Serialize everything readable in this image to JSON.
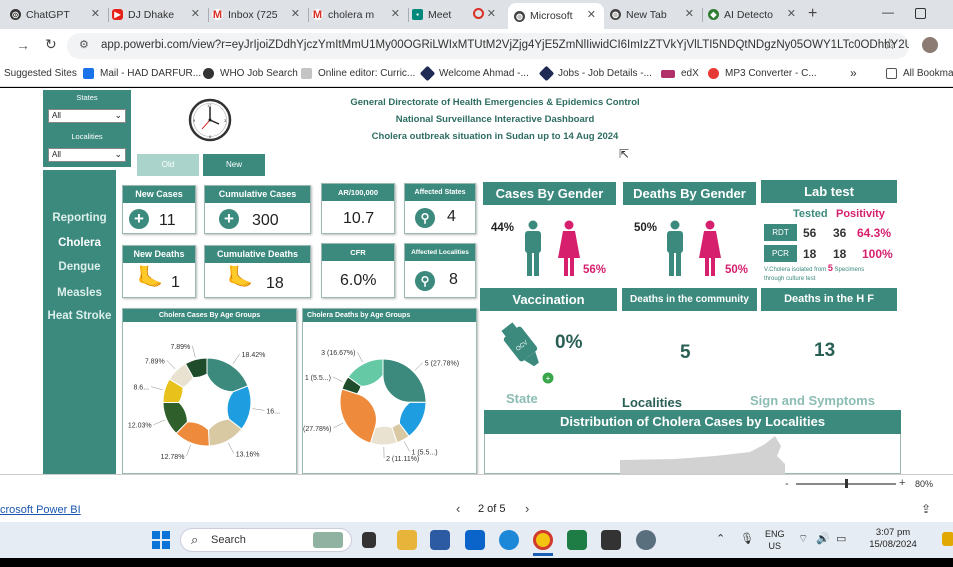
{
  "browser": {
    "tabs": [
      {
        "label": "ChatGPT",
        "color": "#333"
      },
      {
        "label": "DJ Dhake",
        "color": "#e62117"
      },
      {
        "label": "Inbox (725",
        "color": "#d93025"
      },
      {
        "label": "cholera m",
        "color": "#d93025"
      },
      {
        "label": "Meet",
        "color": "#00897b"
      },
      {
        "label": "Microsoft",
        "color": "#444"
      },
      {
        "label": "New Tab",
        "color": "#444"
      },
      {
        "label": "AI Detecto",
        "color": "#2e7d32"
      }
    ],
    "new_tab_symbol": "+",
    "url": "app.powerbi.com/view?r=eyJrIjoiZDdhYjczYmItMmU1My00OGRiLWIxMTUtM2VjZjg4YjE5ZmNlIiwidCI6ImIzZTVkYjVlLTI5NDQtNDgzNy05OWY1LTc0ODhhY2U1N...",
    "bookmarks": [
      "Suggested Sites",
      "Mail - HAD DARFUR...",
      "WHO Job Search",
      "Online editor: Curric...",
      "Welcome Ahmad -...",
      "Jobs - Job Details -...",
      "edX",
      "MP3 Converter - C..."
    ],
    "bookmarks_overflow": "»",
    "all_bookmarks": "All Bookmarks"
  },
  "filters": {
    "states_label": "States",
    "states_value": "All",
    "localities_label": "Localities",
    "localities_value": "All",
    "old_label": "Old",
    "new_label": "New"
  },
  "nav": [
    "Reporting",
    "Cholera",
    "Dengue",
    "Measles",
    "Heat Stroke"
  ],
  "header": {
    "line1": "General Directorate of Health Emergencies &  Epidemics Control",
    "line2": "National Surveillance Interactive Dashboard",
    "line3": "Cholera  outbreak situation in Sudan up to 14 Aug 2024"
  },
  "kpis": {
    "new_cases": {
      "label": "New Cases",
      "value": "11"
    },
    "cumulative_cases": {
      "label": "Cumulative Cases",
      "value": "300"
    },
    "ar": {
      "label": "AR/100,000",
      "value": "10.7"
    },
    "affected_states": {
      "label": "Affected States",
      "value": "4"
    },
    "new_deaths": {
      "label": "New Deaths",
      "value": "1"
    },
    "cumulative_deaths": {
      "label": "Cumulative Deaths",
      "value": "18"
    },
    "cfr": {
      "label": "CFR",
      "value": "6.0%"
    },
    "affected_localities": {
      "label": "Affected Localities",
      "value": "8"
    }
  },
  "gender": {
    "cases_title": "Cases By Gender",
    "cases_male": "44%",
    "cases_female": "56%",
    "deaths_title": "Deaths By Gender",
    "deaths_male": "50%",
    "deaths_female": "50%"
  },
  "lab": {
    "title": "Lab test",
    "tested_label": "Tested",
    "positivity_label": "Positivity",
    "rows": [
      {
        "test": "RDT",
        "tested": "56",
        "positive": "36",
        "positivity": "64.3%"
      },
      {
        "test": "PCR",
        "tested": "18",
        "positive": "18",
        "positivity": "100%"
      }
    ],
    "note_prefix": "V.Cholera isolated from",
    "note_number": "5",
    "note_suffix": "Specimens",
    "note_line2": "through culture test"
  },
  "vaccination": {
    "title": "Vaccination",
    "value": "0%",
    "icon_text": "OCV"
  },
  "community_deaths": {
    "title": "Deaths in the community",
    "value": "5"
  },
  "hf_deaths": {
    "title": "Deaths in the H F",
    "value": "13"
  },
  "bottom_labels": {
    "state": "State",
    "localities": "Localities",
    "signs": "Sign and Symptoms"
  },
  "distribution_title": "Distribution of Cholera Cases by Localities",
  "chart_data": [
    {
      "type": "pie",
      "title": "Cholera Cases By Age Groups",
      "labels_shown": [
        "18.42%",
        "16...",
        "13.16%",
        "12.78%",
        "12.03%",
        "8.6...",
        "7.89%",
        "7.89%"
      ],
      "slices": [
        {
          "value": 18.42,
          "label": "18.42%",
          "color": "#3c8a7e"
        },
        {
          "value": 16.0,
          "label": "16...",
          "color": "#1e9de0"
        },
        {
          "value": 13.16,
          "label": "13.16%",
          "color": "#d9c9a3"
        },
        {
          "value": 12.78,
          "label": "12.78%",
          "color": "#ee8a3c"
        },
        {
          "value": 12.03,
          "label": "12.03%",
          "color": "#2f5f2a"
        },
        {
          "value": 8.6,
          "label": "8.6...",
          "color": "#e8c21a"
        },
        {
          "value": 7.89,
          "label": "7.89%",
          "color": "#e9e2d0"
        },
        {
          "value": 7.89,
          "label": "7.89%",
          "color": "#1f4d2b"
        }
      ]
    },
    {
      "type": "pie",
      "title": "Cholera Deaths by Age Groups",
      "slices": [
        {
          "value": 27.78,
          "label": "5 (27.78%)",
          "color": "#3c8a7e"
        },
        {
          "value": 16.0,
          "label": "",
          "color": "#1e9de0"
        },
        {
          "value": 5.56,
          "label": "1 (5.5...)",
          "color": "#d9c9a3"
        },
        {
          "value": 11.11,
          "label": "2 (11.11%)",
          "color": "#e9e2d0"
        },
        {
          "value": 27.78,
          "label": "5 (27.78%)",
          "color": "#ee8a3c"
        },
        {
          "value": 5.56,
          "label": "1 (5.5...)",
          "color": "#1f4d2b"
        },
        {
          "value": 16.67,
          "label": "3 (16.67%)",
          "color": "#66c9a6"
        }
      ]
    }
  ],
  "footer": {
    "brand": "crosoft Power BI",
    "page": "2 of 5",
    "zoom": "80%"
  },
  "taskbar": {
    "search": "Search",
    "lang1": "ENG",
    "lang2": "US",
    "time": "3:07 pm",
    "date": "15/08/2024"
  }
}
